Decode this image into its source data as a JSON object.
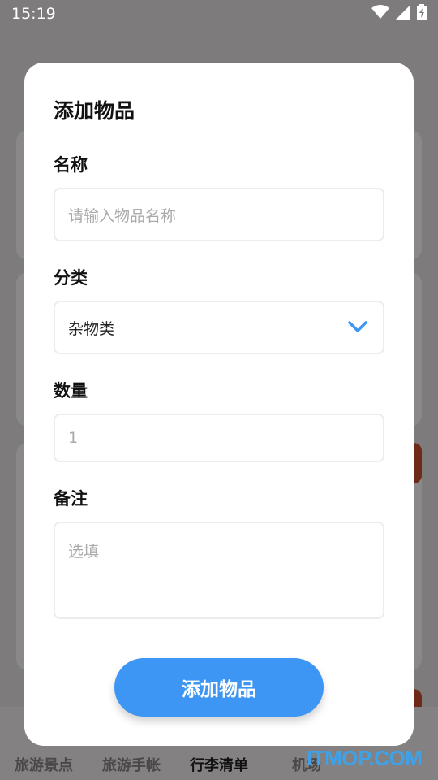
{
  "status_bar": {
    "time": "15:19",
    "icons": [
      "wifi-icon",
      "signal-icon",
      "battery-charging-icon"
    ]
  },
  "dialog": {
    "title": "添加物品",
    "name": {
      "label": "名称",
      "placeholder": "请输入物品名称",
      "value": ""
    },
    "category": {
      "label": "分类",
      "value": "杂物类"
    },
    "quantity": {
      "label": "数量",
      "value": "1"
    },
    "note": {
      "label": "备注",
      "placeholder": "选填",
      "value": ""
    },
    "submit_label": "添加物品"
  },
  "bottom_nav": {
    "items": [
      {
        "label": "旅游景点",
        "active": false
      },
      {
        "label": "旅游手帐",
        "active": false
      },
      {
        "label": "行李清单",
        "active": true
      },
      {
        "label": "机场",
        "active": false
      }
    ]
  },
  "watermark": "ITMOP.COM",
  "colors": {
    "accent": "#3d96f3",
    "overlay_bg": "#7d7b7b",
    "dialog_bg": "#ffffff"
  }
}
